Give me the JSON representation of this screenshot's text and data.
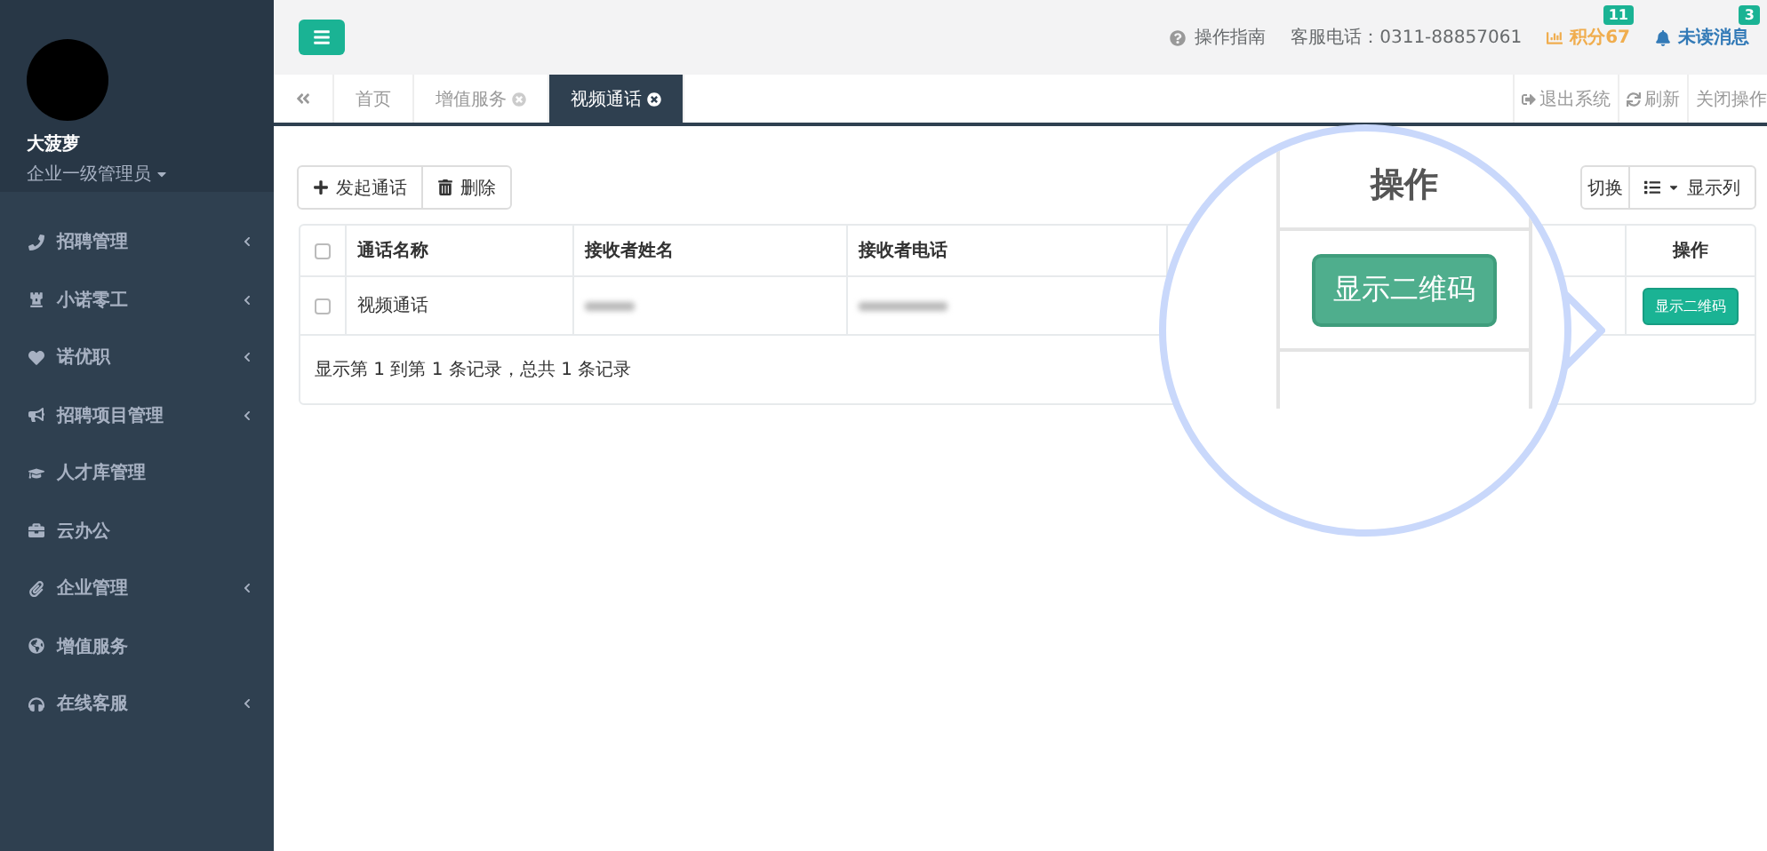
{
  "profile": {
    "name": "大菠萝",
    "role": "企业一级管理员"
  },
  "sidebar": {
    "items": [
      {
        "label": "招聘管理",
        "has_children": true
      },
      {
        "label": "小诺零工",
        "has_children": true
      },
      {
        "label": "诺优职",
        "has_children": true
      },
      {
        "label": "招聘项目管理",
        "has_children": true
      },
      {
        "label": "人才库管理",
        "has_children": false
      },
      {
        "label": "云办公",
        "has_children": false
      },
      {
        "label": "企业管理",
        "has_children": true
      },
      {
        "label": "增值服务",
        "has_children": false
      },
      {
        "label": "在线客服",
        "has_children": true
      }
    ]
  },
  "header": {
    "guide": "操作指南",
    "hotline": "客服电话：0311-88857061",
    "points": {
      "label": "积分67",
      "badge": "11"
    },
    "messages": {
      "label": "未读消息",
      "badge": "3"
    }
  },
  "tabs": [
    {
      "label": "首页",
      "closable": false,
      "selected": false
    },
    {
      "label": "增值服务",
      "closable": true,
      "selected": false
    },
    {
      "label": "视频通话",
      "closable": true,
      "selected": true
    }
  ],
  "tab_actions": [
    "退出系统",
    "刷新",
    "关闭操作"
  ],
  "toolbar": {
    "buttons": [
      "发起通话",
      "删除"
    ],
    "right": [
      "切换",
      "显示列"
    ]
  },
  "table": {
    "columns": [
      "通话名称",
      "接收者姓名",
      "接收者电话",
      "操作"
    ],
    "header_checked": false,
    "rows": [
      {
        "checked": false,
        "cells": [
          {
            "kind": "text",
            "text": "视频通话"
          },
          {
            "kind": "blurred"
          },
          {
            "kind": "blurred"
          }
        ],
        "action": "显示二维码"
      }
    ],
    "footer": "显示第 1 到第 1 条记录，总共 1 条记录"
  },
  "magnifier": {
    "heading": "操作",
    "button": "显示二维码"
  }
}
